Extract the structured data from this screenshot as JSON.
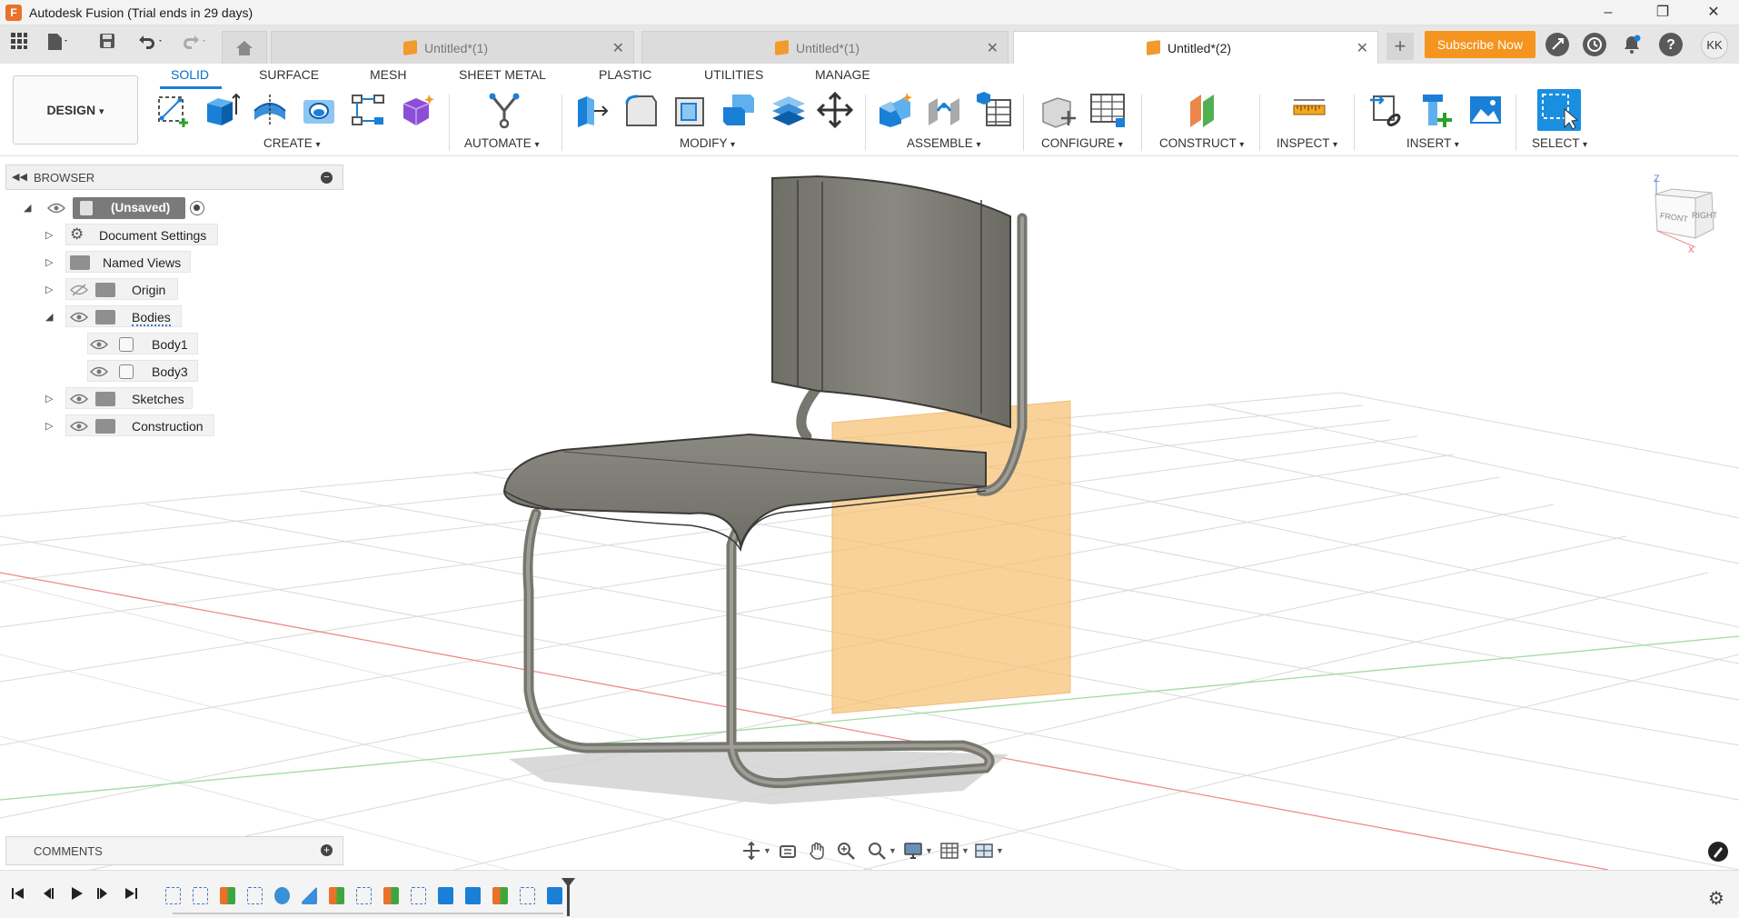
{
  "titlebar": {
    "logo_letter": "F",
    "title": "Autodesk Fusion (Trial ends in 29 days)",
    "minimize": "–",
    "restore": "❐",
    "close": "✕"
  },
  "tabs": [
    {
      "label": "Untitled*(1)",
      "active": false
    },
    {
      "label": "Untitled*(1)",
      "active": false
    },
    {
      "label": "Untitled*(2)",
      "active": true
    }
  ],
  "tab_close_glyph": "✕",
  "tab_new_glyph": "+",
  "subscribe_label": "Subscribe Now",
  "user_initials": "KK",
  "workspace": "DESIGN",
  "ribbon_tabs": [
    "SOLID",
    "SURFACE",
    "MESH",
    "SHEET METAL",
    "PLASTIC",
    "UTILITIES",
    "MANAGE"
  ],
  "groups": {
    "create": "CREATE",
    "automate": "AUTOMATE",
    "modify": "MODIFY",
    "assemble": "ASSEMBLE",
    "configure": "CONFIGURE",
    "construct": "CONSTRUCT",
    "inspect": "INSPECT",
    "insert": "INSERT",
    "select": "SELECT"
  },
  "dropdown_caret": "▾",
  "browser": {
    "title": "BROWSER",
    "root": "(Unsaved)",
    "items": {
      "document_settings": "Document Settings",
      "named_views": "Named Views",
      "origin": "Origin",
      "bodies": "Bodies",
      "body1": "Body1",
      "body3": "Body3",
      "sketches": "Sketches",
      "construction": "Construction"
    }
  },
  "viewcube": {
    "front": "FRONT",
    "right": "RIGHT",
    "z": "Z",
    "x": "X"
  },
  "comments": {
    "title": "COMMENTS",
    "add": "+"
  },
  "colors": {
    "accent": "#0a6fc2",
    "subscribe": "#f5951f",
    "plane": "#f7c070",
    "model": "#7b7a72"
  }
}
